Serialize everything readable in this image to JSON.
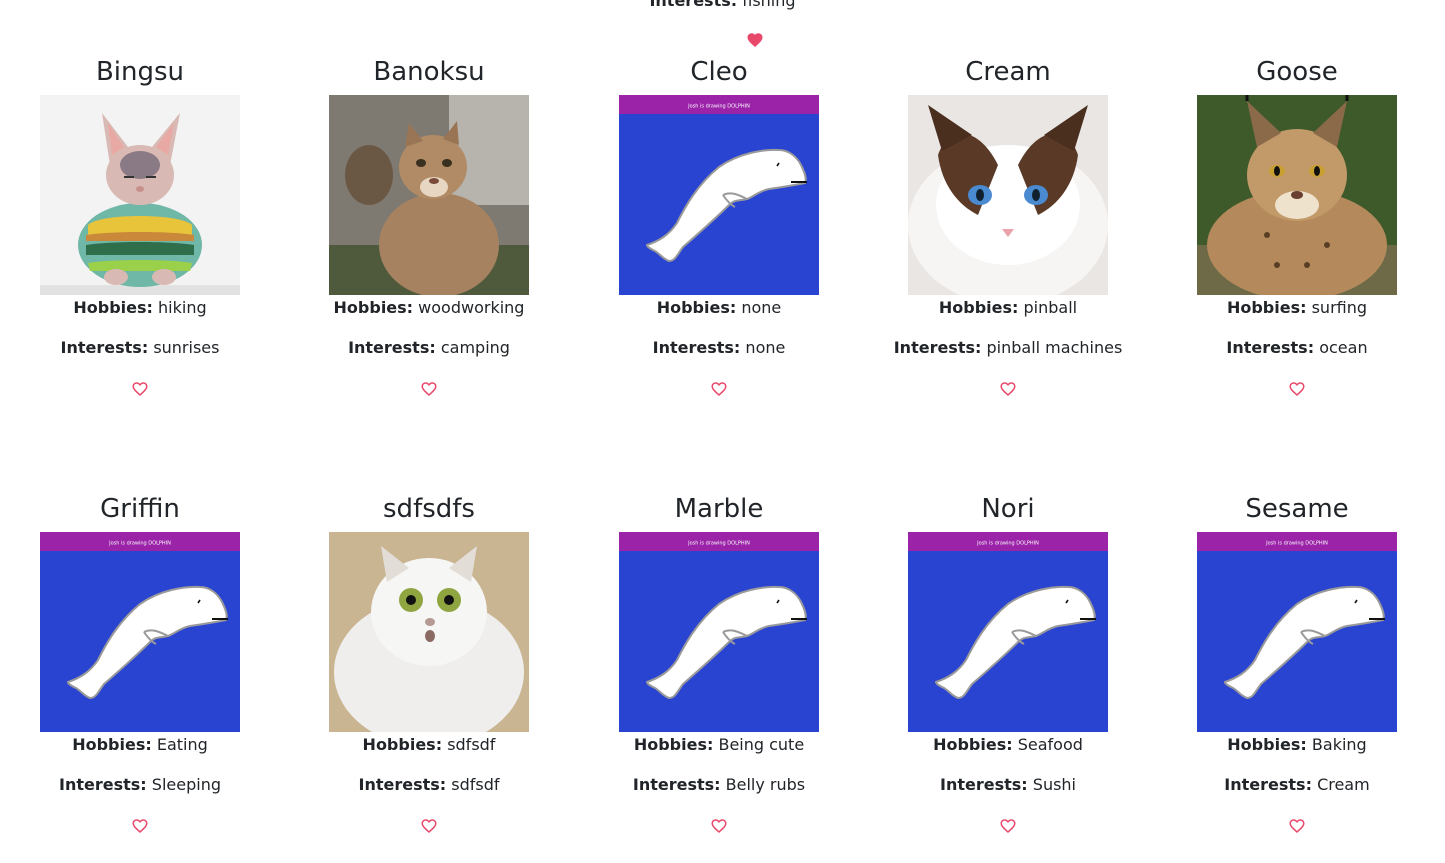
{
  "top_partial": {
    "interests_label": "Interests:",
    "interests_value": "fishing",
    "heart_icon": "heart-filled-icon",
    "heart_color": "#e8486a"
  },
  "labels": {
    "hobbies": "Hobbies:",
    "interests": "Interests:"
  },
  "heart_color": "#e8486a",
  "cards": [
    {
      "name": "Bingsu",
      "hobbies": "hiking",
      "interests": "sunrises",
      "photo": "sphynx-cat-photo"
    },
    {
      "name": "Banoksu",
      "hobbies": "woodworking",
      "interests": "camping",
      "photo": "cougar-photo"
    },
    {
      "name": "Cleo",
      "hobbies": "none",
      "interests": "none",
      "photo": "dolphin-drawing",
      "drawing_caption": "Josh is drawing DOLPHIN"
    },
    {
      "name": "Cream",
      "hobbies": "pinball",
      "interests": "pinball machines",
      "photo": "ragdoll-cat-photo"
    },
    {
      "name": "Goose",
      "hobbies": "surfing",
      "interests": "ocean",
      "photo": "lynx-photo"
    },
    {
      "name": "Griffin",
      "hobbies": "Eating",
      "interests": "Sleeping",
      "photo": "dolphin-drawing",
      "drawing_caption": "Josh is drawing DOLPHIN"
    },
    {
      "name": "sdfsdfs",
      "hobbies": "sdfsdf",
      "interests": "sdfsdf",
      "photo": "persian-cat-photo"
    },
    {
      "name": "Marble",
      "hobbies": "Being cute",
      "interests": "Belly rubs",
      "photo": "dolphin-drawing",
      "drawing_caption": "Josh is drawing DOLPHIN"
    },
    {
      "name": "Nori",
      "hobbies": "Seafood",
      "interests": "Sushi",
      "photo": "dolphin-drawing",
      "drawing_caption": "Josh is drawing DOLPHIN"
    },
    {
      "name": "Sesame",
      "hobbies": "Baking",
      "interests": "Cream",
      "photo": "dolphin-drawing",
      "drawing_caption": "Josh is drawing DOLPHIN"
    }
  ]
}
